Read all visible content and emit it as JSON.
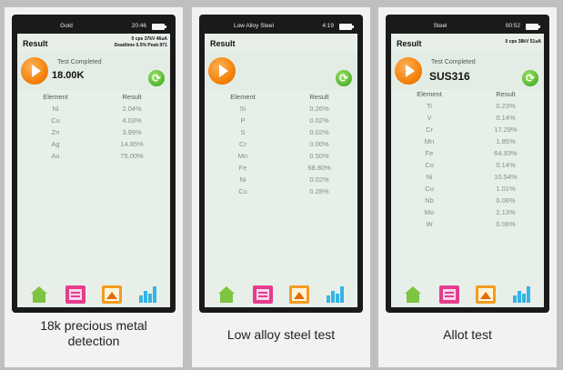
{
  "panels": [
    {
      "status": {
        "mode": "Gold",
        "time": "20:46"
      },
      "header": {
        "title": "Result",
        "params_line1": "0 cps 37kV 46uA",
        "params_line2": "Deadtime 0.5% Peak:971"
      },
      "status_text": "Test Completed",
      "big_value": "18.00K",
      "table": {
        "headers": [
          "Element",
          "Result"
        ],
        "rows": [
          [
            "Ni",
            "2.04%"
          ],
          [
            "Cu",
            "4.03%"
          ],
          [
            "Zn",
            "3.99%"
          ],
          [
            "Ag",
            "14.85%"
          ],
          [
            "Au",
            "75.00%"
          ]
        ]
      },
      "caption": "18k precious metal detection"
    },
    {
      "status": {
        "mode": "Low Alloy Steel",
        "time": "4:19"
      },
      "header": {
        "title": "Result",
        "params_line1": "",
        "params_line2": ""
      },
      "status_text": "",
      "big_value": "",
      "table": {
        "headers": [
          "Element",
          "Result"
        ],
        "rows": [
          [
            "Si",
            "0.26%"
          ],
          [
            "P",
            "0.02%"
          ],
          [
            "S",
            "0.02%"
          ],
          [
            "Cr",
            "0.00%"
          ],
          [
            "Mn",
            "0.50%"
          ],
          [
            "Fe",
            "98.80%"
          ],
          [
            "Ni",
            "0.02%"
          ],
          [
            "Cu",
            "0.28%"
          ]
        ]
      },
      "caption": "Low alloy steel test"
    },
    {
      "status": {
        "mode": "Steel",
        "time": "00:52"
      },
      "header": {
        "title": "Result",
        "params_line1": "0 cps 38kV 51uA",
        "params_line2": ""
      },
      "status_text": "Test Completed",
      "big_value": "SUS316",
      "table": {
        "headers": [
          "Element",
          "Result"
        ],
        "rows": [
          [
            "Ti",
            "0.23%"
          ],
          [
            "V",
            "0.14%"
          ],
          [
            "Cr",
            "17.29%"
          ],
          [
            "Mn",
            "1.85%"
          ],
          [
            "Fe",
            "64.93%"
          ],
          [
            "Co",
            "0.14%"
          ],
          [
            "Ni",
            "10.54%"
          ],
          [
            "Cu",
            "1.01%"
          ],
          [
            "Nb",
            "0.06%"
          ],
          [
            "Mo",
            "2.13%"
          ],
          [
            "W",
            "0.06%"
          ]
        ]
      },
      "caption": "Allot test"
    }
  ],
  "icons": {
    "play": "play-button-icon",
    "refresh": "refresh-icon",
    "home": "home-icon",
    "report": "report-icon",
    "spectrum": "spectrum-icon",
    "stats": "statistics-icon",
    "battery": "battery-icon"
  },
  "colors": {
    "screen_bg": "#e6f0e8",
    "accent_orange": "#f27a00",
    "accent_green": "#4fb52a",
    "report_pink": "#e53c8f",
    "stats_blue": "#35b4e6"
  }
}
